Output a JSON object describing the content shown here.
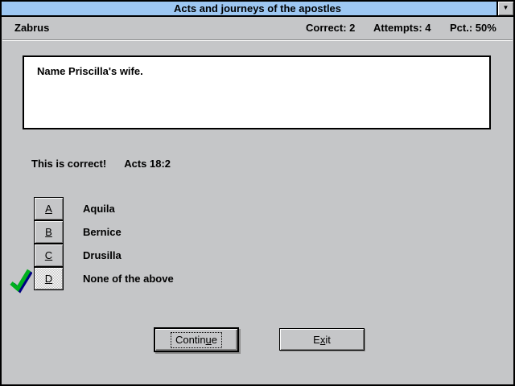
{
  "window": {
    "title": "Acts and journeys of the apostles",
    "menu_button_glyph": "▼"
  },
  "header": {
    "player_name": "Zabrus",
    "correct_text": "Correct: 2",
    "attempts_text": "Attempts: 4",
    "pct_text": "Pct.: 50%"
  },
  "question": {
    "text": "Name Priscilla's wife."
  },
  "feedback": {
    "result": "This is correct!",
    "reference": "Acts 18:2"
  },
  "answers": [
    {
      "key": "A",
      "label": "Aquila",
      "selected": false
    },
    {
      "key": "B",
      "label": "Bernice",
      "selected": false
    },
    {
      "key": "C",
      "label": "Drusilla",
      "selected": false
    },
    {
      "key": "D",
      "label": "None of the above",
      "selected": true
    }
  ],
  "actions": {
    "continue": {
      "pre": "Contin",
      "accel": "u",
      "post": "e"
    },
    "exit": {
      "pre": "E",
      "accel": "x",
      "post": "it"
    }
  },
  "colors": {
    "titlebar": "#9DC7F2",
    "background": "#C5C6C8",
    "check_green": "#00B01E",
    "check_shadow": "#000082"
  }
}
